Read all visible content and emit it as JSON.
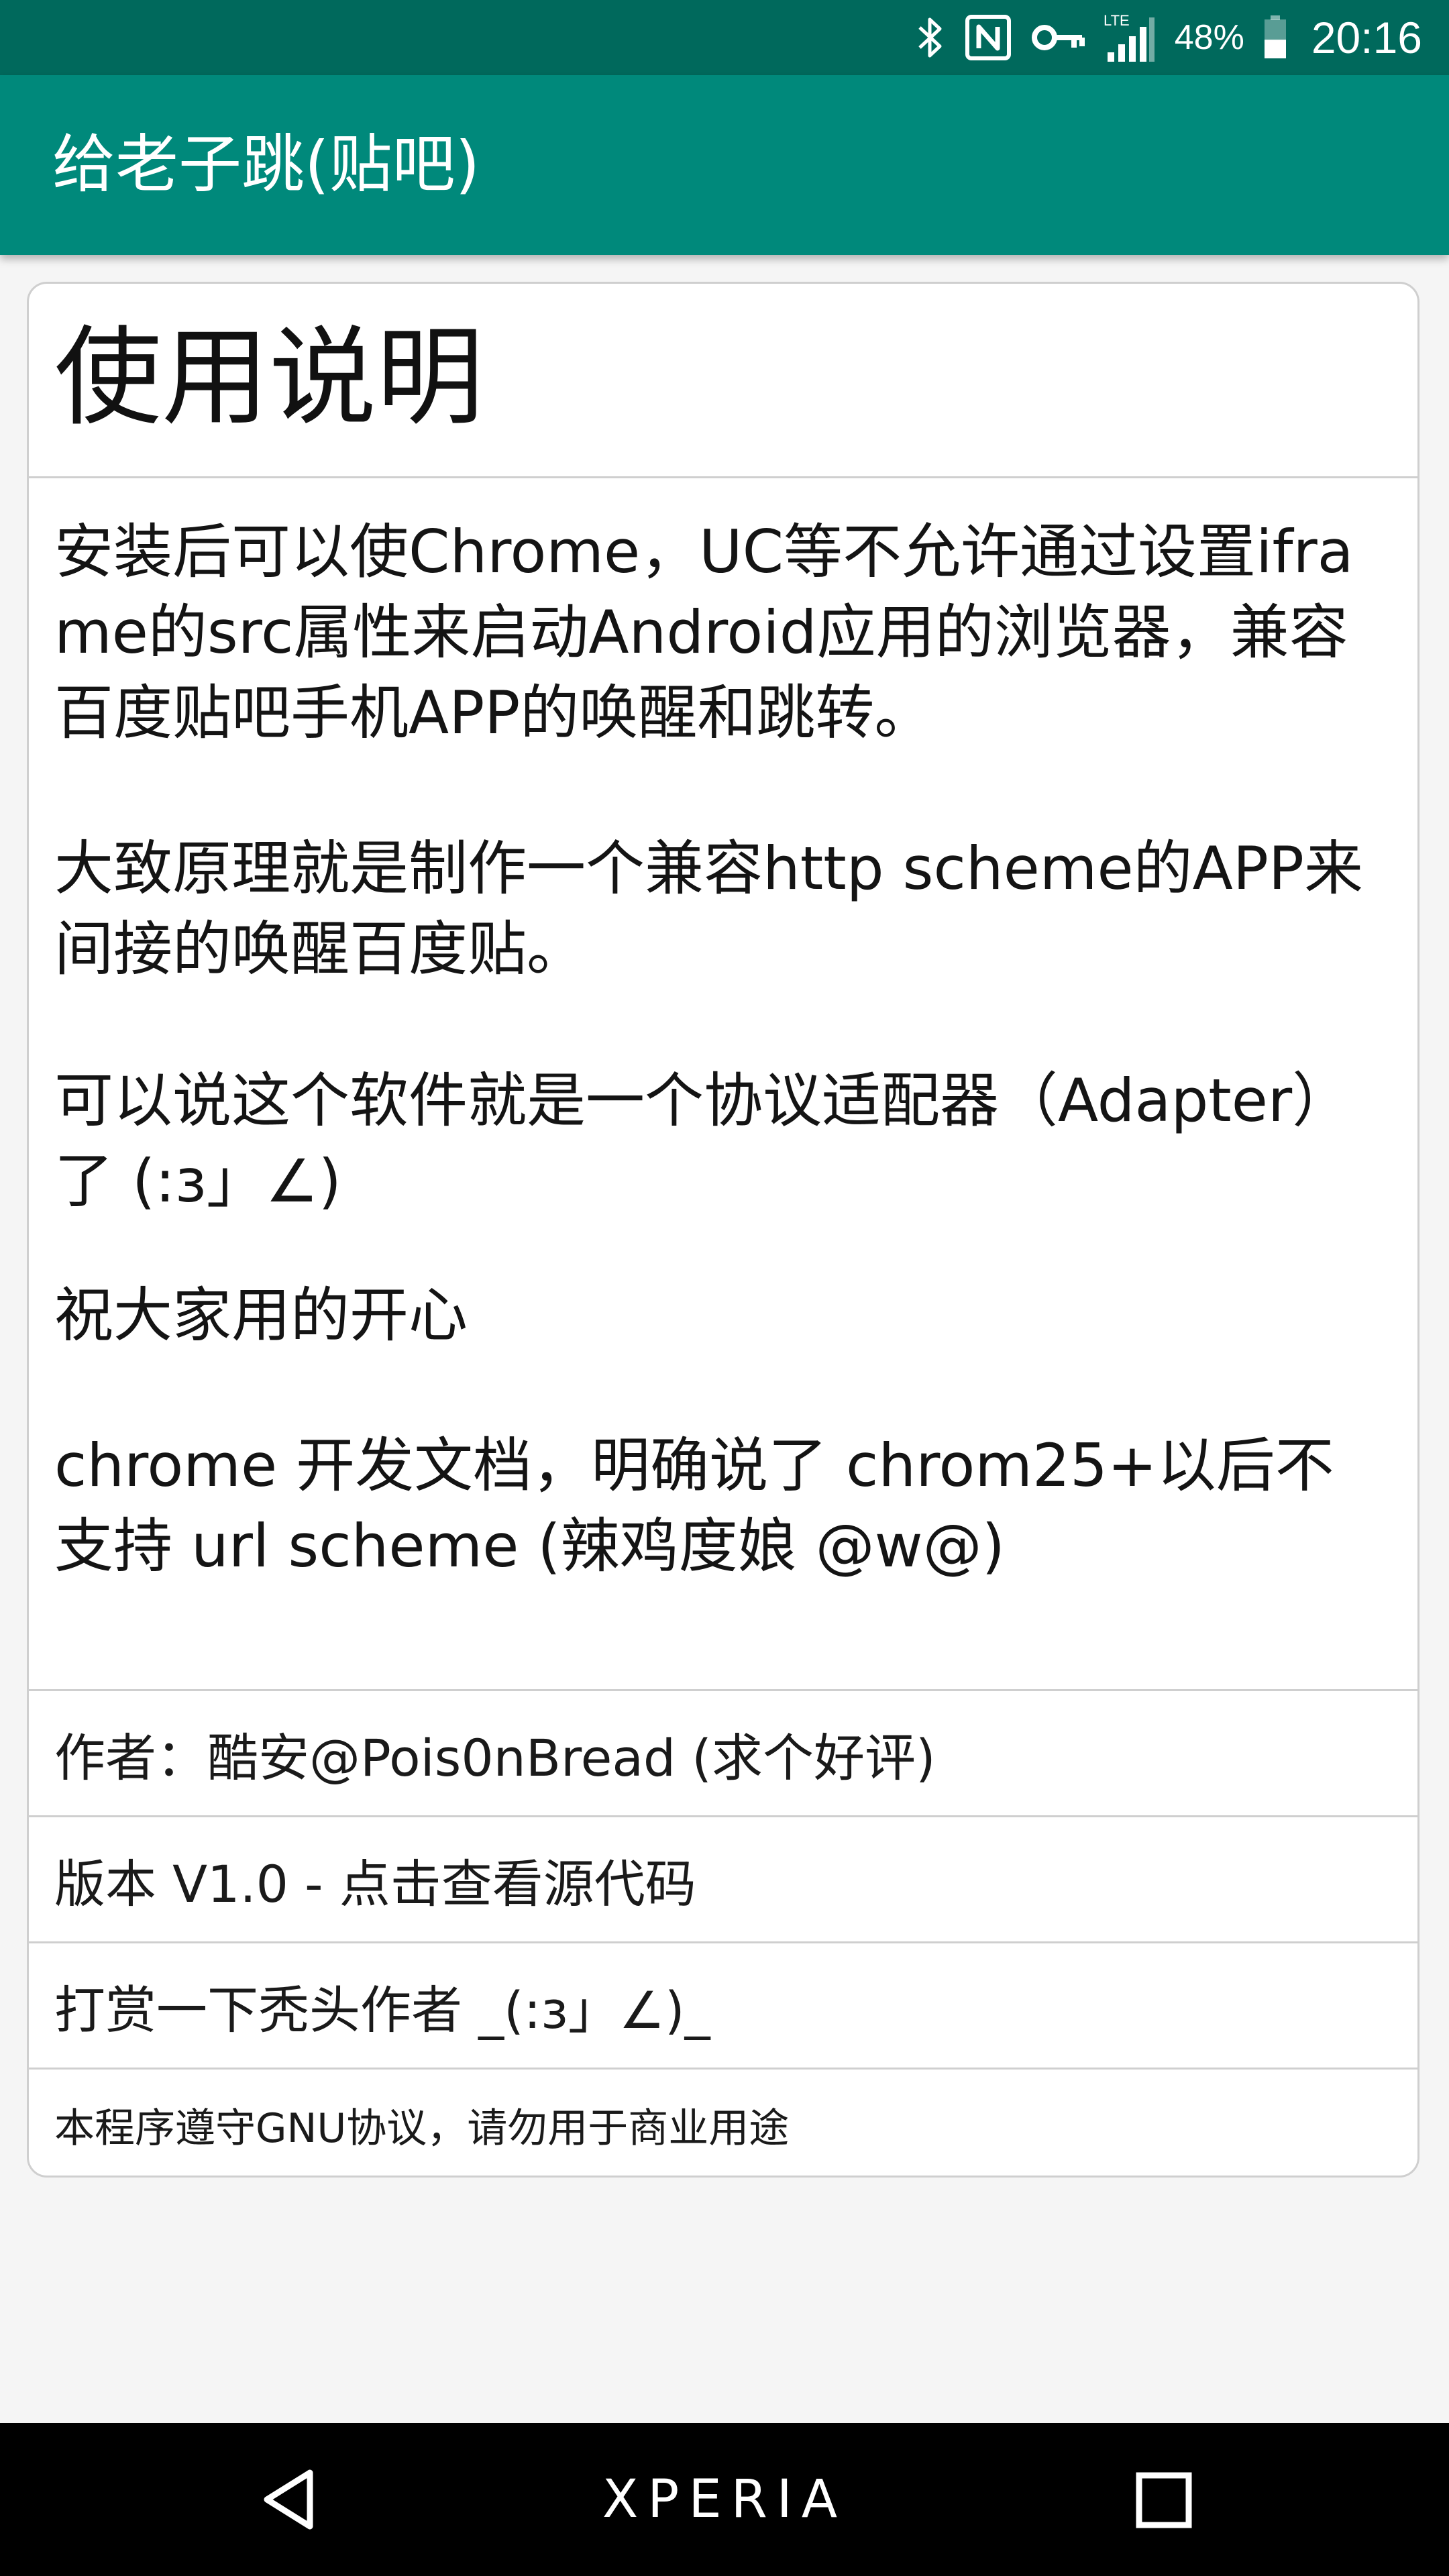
{
  "status_bar": {
    "icons": [
      "bluetooth-icon",
      "nfc-icon",
      "vpn-key-icon",
      "lte-signal-icon",
      "battery-icon"
    ],
    "network_label": "LTE",
    "battery": "48%",
    "battery_level": 0.48,
    "time": "20:16"
  },
  "app_bar": {
    "title": "给老子跳(贴吧)"
  },
  "card": {
    "heading": "使用说明",
    "paragraphs": [
      "安装后可以使Chrome，UC等不允许通过设置iframe的src属性来启动Android应用的浏览器，兼容百度贴吧手机APP的唤醒和跳转。",
      "大致原理就是制作一个兼容http scheme的APP来间接的唤醒百度贴。",
      "可以说这个软件就是一个协议适配器（Adapter）了 (:з」∠)",
      "祝大家用的开心",
      "chrome 开发文档，明确说了 chrom25+以后不支持 url scheme (辣鸡度娘 @w@)"
    ],
    "author": "作者：酷安@Pois0nBread (求个好评)",
    "version": "版本 V1.0 - 点击查看源代码",
    "donate": "打赏一下秃头作者 _(:з」∠)_",
    "license": "本程序遵守GNU协议，请勿用于商业用途"
  },
  "nav_bar": {
    "brand": "XPERIA",
    "icons": [
      "back-icon",
      "recent-apps-icon"
    ]
  },
  "colors": {
    "status_bar": "#00695c",
    "app_bar": "#00897b",
    "background": "#f5f5f5",
    "nav_bar": "#000000"
  }
}
